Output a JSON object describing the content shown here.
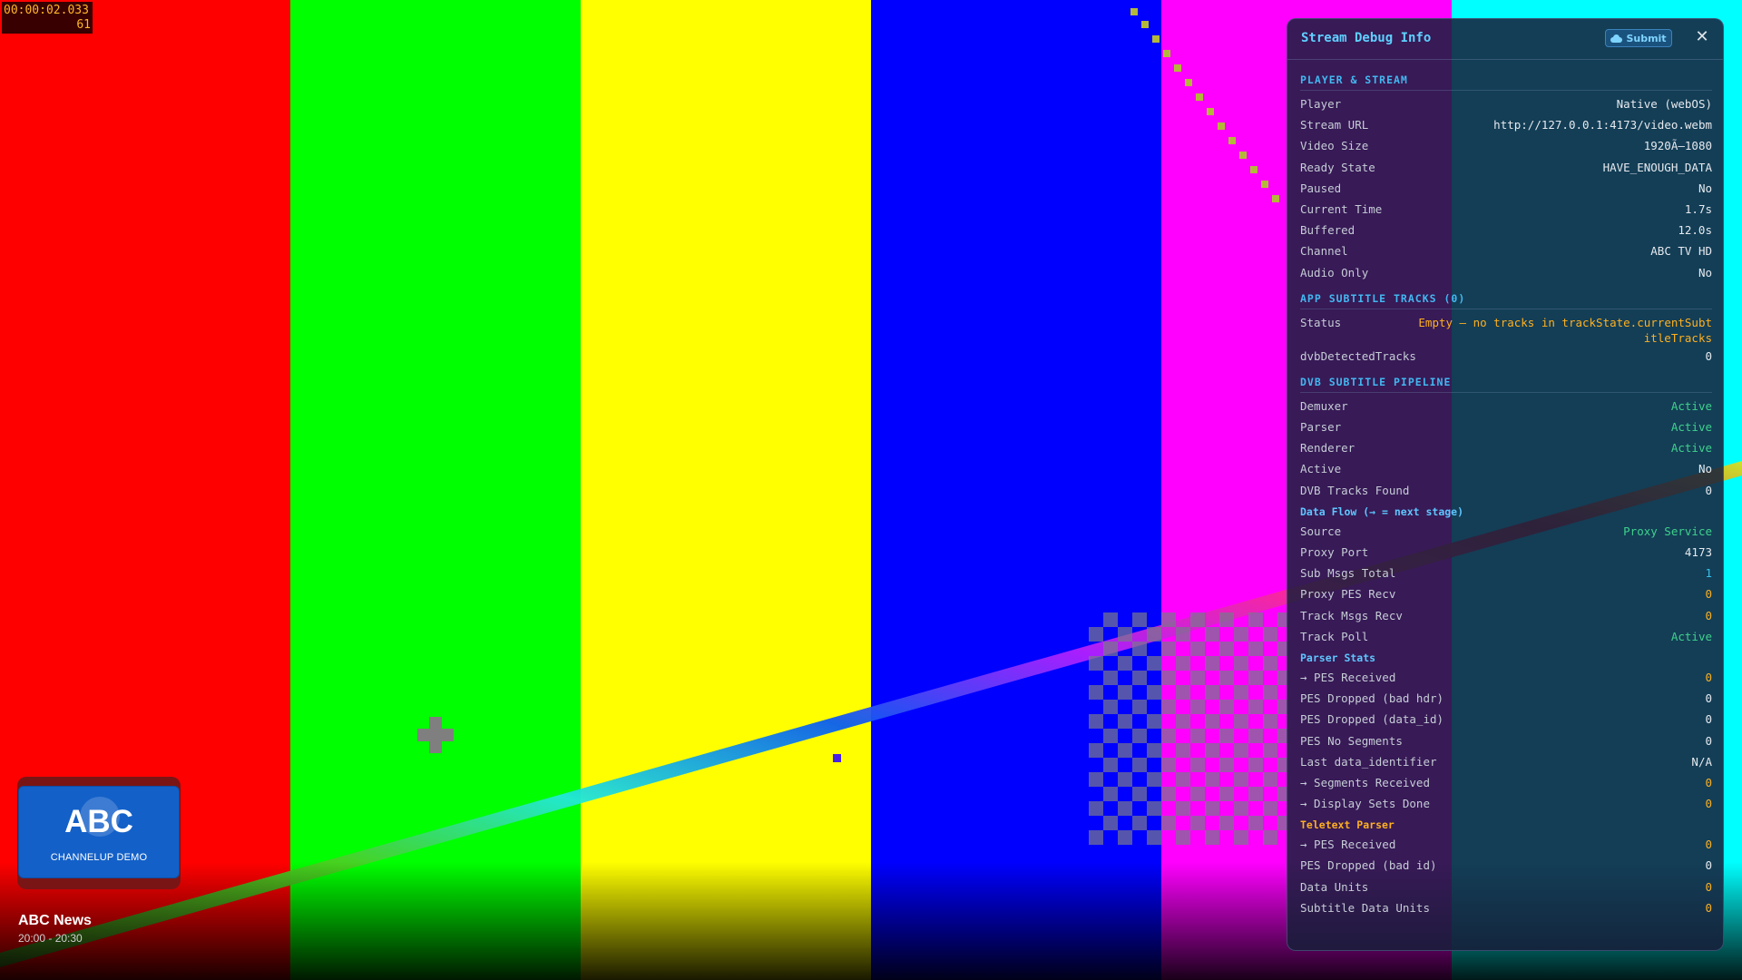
{
  "overlay": {
    "timecode": "00:00:02.033",
    "frame": "61"
  },
  "pattern_colors": [
    "#ff0000",
    "#00ff00",
    "#ffff00",
    "#0000ff",
    "#ff00ff",
    "#00ffff"
  ],
  "channel": {
    "logo_text": "ABC",
    "logo_sub": "CHANNELUP DEMO",
    "program_title": "ABC News",
    "program_time": "20:00 - 20:30"
  },
  "debug": {
    "title": "Stream Debug Info",
    "submit_label": "Submit",
    "close_label": "✕",
    "sections": {
      "player": {
        "title": "PLAYER & STREAM",
        "rows": [
          {
            "k": "Player",
            "v": "Native (webOS)"
          },
          {
            "k": "Stream URL",
            "v": "http://127.0.0.1:4173/video.webm"
          },
          {
            "k": "Video Size",
            "v": "1920Ã—1080"
          },
          {
            "k": "Ready State",
            "v": "HAVE_ENOUGH_DATA"
          },
          {
            "k": "Paused",
            "v": "No"
          },
          {
            "k": "Current Time",
            "v": "1.7s"
          },
          {
            "k": "Buffered",
            "v": "12.0s"
          },
          {
            "k": "Channel",
            "v": "ABC TV HD"
          },
          {
            "k": "Audio Only",
            "v": "No"
          }
        ]
      },
      "app_subs": {
        "title": "APP SUBTITLE TRACKS (0)",
        "rows": [
          {
            "k": "Status",
            "v": "Empty — no tracks in trackState.currentSubtitleTracks"
          },
          {
            "k": "dvbDetectedTracks",
            "v": "0"
          }
        ]
      },
      "dvb": {
        "title": "DVB SUBTITLE PIPELINE",
        "rows": [
          {
            "k": "Demuxer",
            "v": "Active"
          },
          {
            "k": "Parser",
            "v": "Active"
          },
          {
            "k": "Renderer",
            "v": "Active"
          },
          {
            "k": "Active",
            "v": "No"
          },
          {
            "k": "DVB Tracks Found",
            "v": "0"
          }
        ],
        "flow_title": "Data Flow (→ = next stage)",
        "flow_rows": [
          {
            "k": "Source",
            "v": "Proxy Service"
          },
          {
            "k": "Proxy Port",
            "v": "4173"
          },
          {
            "k": "Sub Msgs Total",
            "v": "1"
          },
          {
            "k": "Proxy PES Recv",
            "v": "0"
          },
          {
            "k": "Track Msgs Recv",
            "v": "0"
          },
          {
            "k": "Track Poll",
            "v": "Active"
          }
        ],
        "parser_title": "Parser Stats",
        "parser_rows": [
          {
            "k": "→ PES Received",
            "v": "0"
          },
          {
            "k": "PES Dropped (bad hdr)",
            "v": "0"
          },
          {
            "k": "PES Dropped (data_id)",
            "v": "0"
          },
          {
            "k": "PES No Segments",
            "v": "0"
          },
          {
            "k": "Last data_identifier",
            "v": "N/A"
          },
          {
            "k": "→ Segments Received",
            "v": "0"
          },
          {
            "k": "→ Display Sets Done",
            "v": "0"
          }
        ],
        "teletext_title": "Teletext Parser",
        "teletext_rows": [
          {
            "k": "→ PES Received",
            "v": "0"
          },
          {
            "k": "PES Dropped (bad id)",
            "v": "0"
          },
          {
            "k": "Data Units",
            "v": "0"
          },
          {
            "k": "Subtitle Data Units",
            "v": "0"
          }
        ]
      }
    }
  }
}
